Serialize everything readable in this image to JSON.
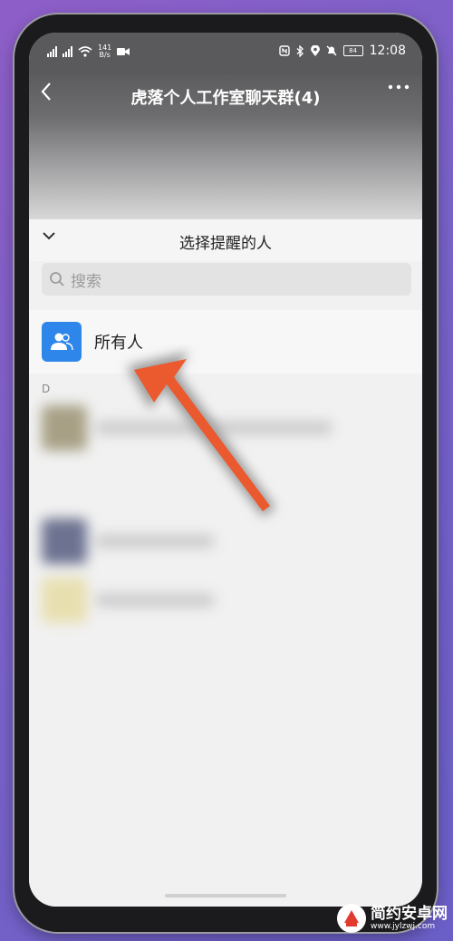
{
  "status_bar": {
    "speed_value": "141",
    "speed_unit": "B/s",
    "battery": "84",
    "time": "12:08"
  },
  "chat": {
    "title": "虎落个人工作室聊天群(4)"
  },
  "mention_sheet": {
    "title": "选择提醒的人",
    "search_placeholder": "搜索",
    "everyone_label": "所有人",
    "section_letter": "D"
  },
  "watermark": {
    "name": "简约安卓网",
    "url": "www.jylzwj.com"
  },
  "colors": {
    "everyone_avatar": "#2f86ea",
    "arrow": "#ea5a2e"
  }
}
